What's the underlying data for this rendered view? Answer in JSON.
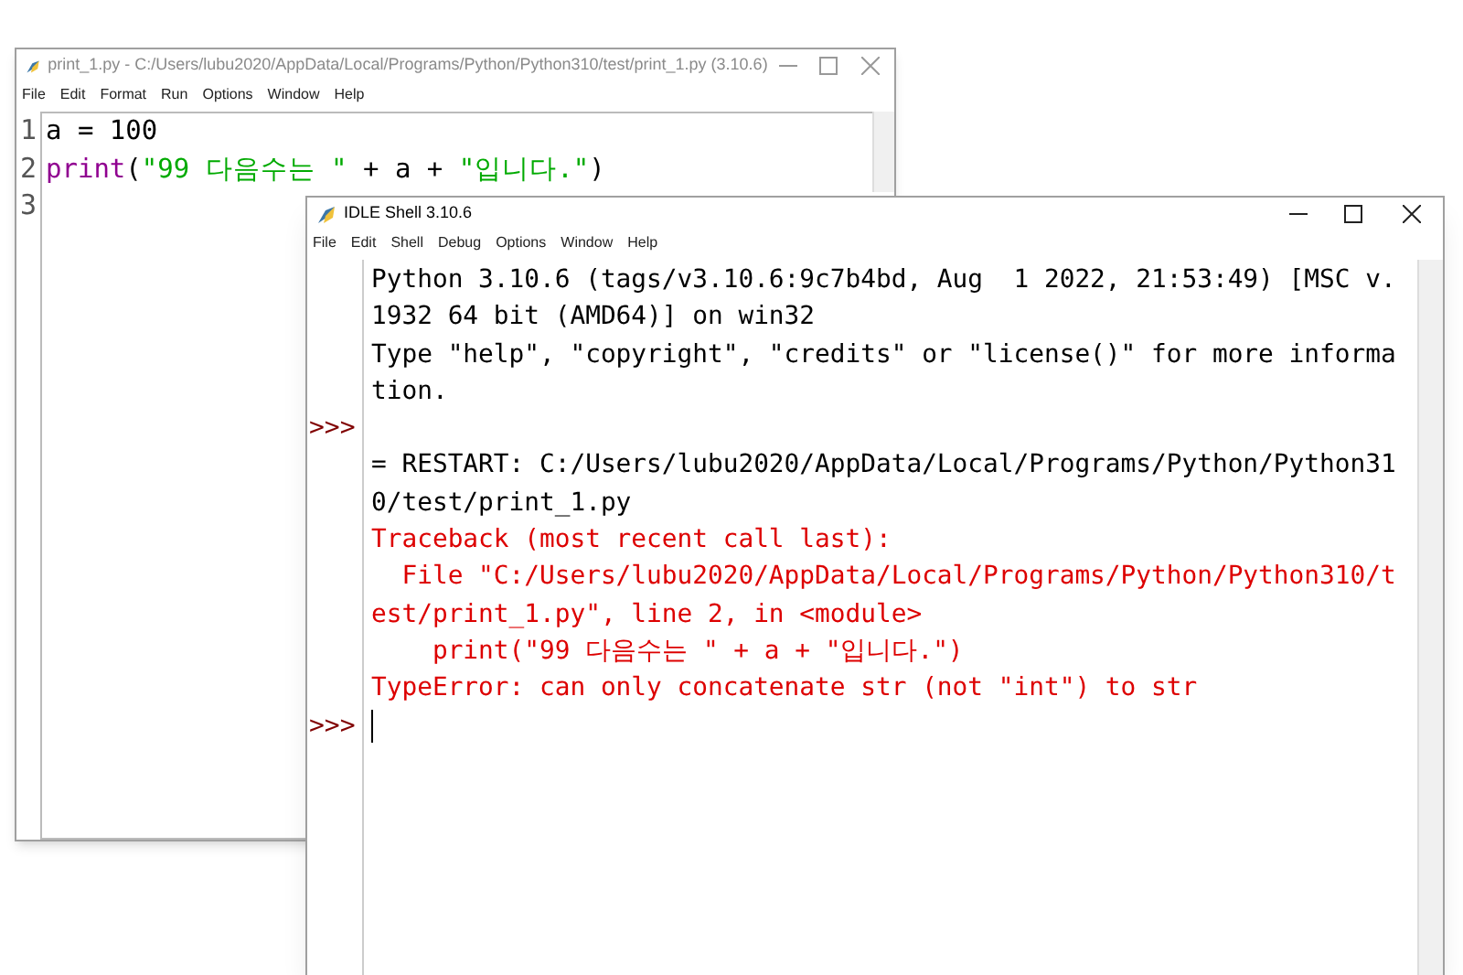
{
  "editor": {
    "title": "print_1.py - C:/Users/lubu2020/AppData/Local/Programs/Python/Python310/test/print_1.py (3.10.6)",
    "active": false,
    "menu": [
      "File",
      "Edit",
      "Format",
      "Run",
      "Options",
      "Window",
      "Help"
    ],
    "line_numbers": [
      "1",
      "2",
      "3"
    ],
    "lines": [
      [
        {
          "kind": "plain",
          "text": "a = 100"
        }
      ],
      [
        {
          "kind": "builtin",
          "text": "print"
        },
        {
          "kind": "plain",
          "text": "("
        },
        {
          "kind": "string",
          "text": "\"99 다음수는 \""
        },
        {
          "kind": "plain",
          "text": " + a + "
        },
        {
          "kind": "string",
          "text": "\"입니다.\""
        },
        {
          "kind": "plain",
          "text": ")"
        }
      ]
    ]
  },
  "shell": {
    "title": "IDLE Shell 3.10.6",
    "active": true,
    "menu": [
      "File",
      "Edit",
      "Shell",
      "Debug",
      "Options",
      "Window",
      "Help"
    ],
    "lines": [
      {
        "kind": "stdout",
        "text": "Python 3.10.6 (tags/v3.10.6:9c7b4bd, Aug  1 2022, 21:53:49) [MSC v."
      },
      {
        "kind": "stdout",
        "text": "1932 64 bit (AMD64)] on win32"
      },
      {
        "kind": "stdout",
        "text": "Type \"help\", \"copyright\", \"credits\" or \"license()\" for more informa"
      },
      {
        "kind": "stdout",
        "text": "tion."
      },
      {
        "prompt": ">>>",
        "kind": "stdout"
      },
      {
        "kind": "stdout",
        "text": "= RESTART: C:/Users/lubu2020/AppData/Local/Programs/Python/Python31"
      },
      {
        "kind": "stdout",
        "text": "0/test/print_1.py"
      },
      {
        "kind": "stderr",
        "text": "Traceback (most recent call last):"
      },
      {
        "kind": "stderr",
        "text": "  File \"C:/Users/lubu2020/AppData/Local/Programs/Python/Python310/t"
      },
      {
        "kind": "stderr",
        "text": "est/print_1.py\", line 2, in <module>"
      },
      {
        "kind": "stderr",
        "text": "    print(\"99 다음수는 \" + a + \"입니다.\")"
      },
      {
        "kind": "stderr",
        "text": "TypeError: can only concatenate str (not \"int\") to str"
      },
      {
        "prompt": ">>>",
        "kind": "input"
      }
    ]
  }
}
